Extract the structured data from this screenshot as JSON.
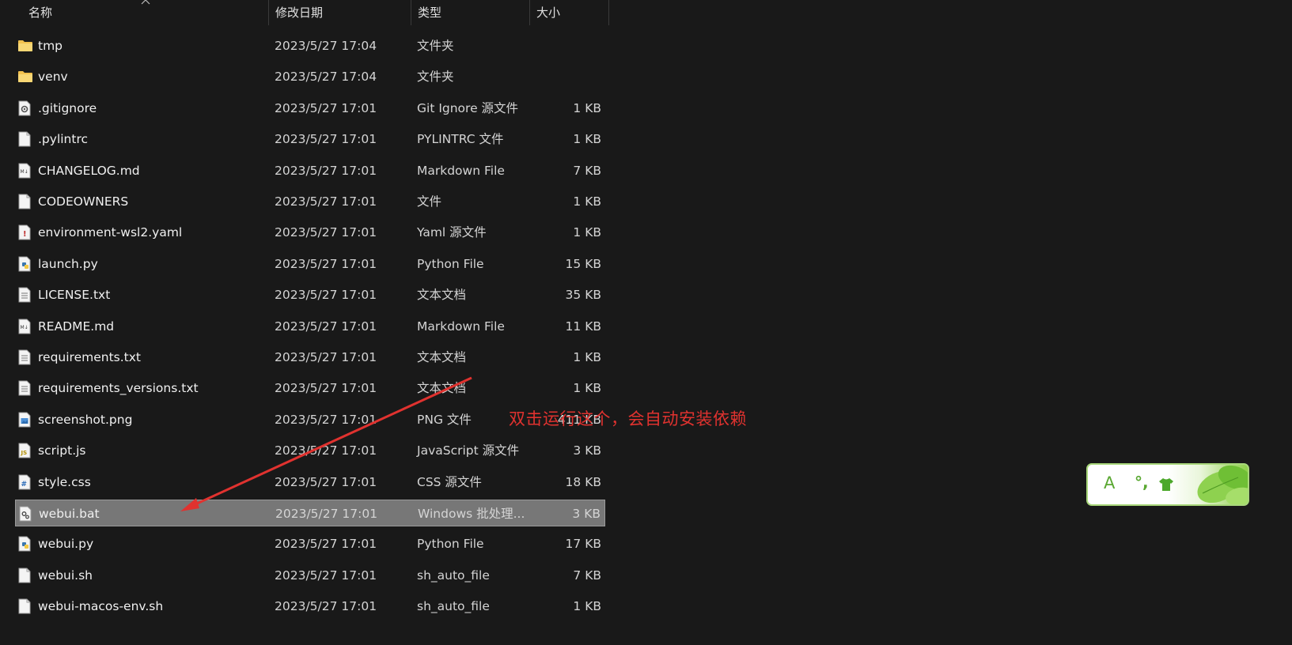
{
  "header": {
    "name": "名称",
    "date": "修改日期",
    "type": "类型",
    "size": "大小"
  },
  "files": [
    {
      "name": "tmp",
      "date": "2023/5/27 17:04",
      "type": "文件夹",
      "size": "",
      "icon": "folder-icon"
    },
    {
      "name": "venv",
      "date": "2023/5/27 17:04",
      "type": "文件夹",
      "size": "",
      "icon": "folder-icon"
    },
    {
      "name": ".gitignore",
      "date": "2023/5/27 17:01",
      "type": "Git Ignore 源文件",
      "size": "1 KB",
      "icon": "config-file-icon"
    },
    {
      "name": ".pylintrc",
      "date": "2023/5/27 17:01",
      "type": "PYLINTRC 文件",
      "size": "1 KB",
      "icon": "blank-file-icon"
    },
    {
      "name": "CHANGELOG.md",
      "date": "2023/5/27 17:01",
      "type": "Markdown File",
      "size": "7 KB",
      "icon": "markdown-file-icon"
    },
    {
      "name": "CODEOWNERS",
      "date": "2023/5/27 17:01",
      "type": "文件",
      "size": "1 KB",
      "icon": "blank-file-icon"
    },
    {
      "name": "environment-wsl2.yaml",
      "date": "2023/5/27 17:01",
      "type": "Yaml 源文件",
      "size": "1 KB",
      "icon": "yaml-file-icon"
    },
    {
      "name": "launch.py",
      "date": "2023/5/27 17:01",
      "type": "Python File",
      "size": "15 KB",
      "icon": "python-file-icon"
    },
    {
      "name": "LICENSE.txt",
      "date": "2023/5/27 17:01",
      "type": "文本文档",
      "size": "35 KB",
      "icon": "text-file-icon"
    },
    {
      "name": "README.md",
      "date": "2023/5/27 17:01",
      "type": "Markdown File",
      "size": "11 KB",
      "icon": "markdown-file-icon"
    },
    {
      "name": "requirements.txt",
      "date": "2023/5/27 17:01",
      "type": "文本文档",
      "size": "1 KB",
      "icon": "text-file-icon"
    },
    {
      "name": "requirements_versions.txt",
      "date": "2023/5/27 17:01",
      "type": "文本文档",
      "size": "1 KB",
      "icon": "text-file-icon"
    },
    {
      "name": "screenshot.png",
      "date": "2023/5/27 17:01",
      "type": "PNG 文件",
      "size": "411 KB",
      "icon": "image-file-icon"
    },
    {
      "name": "script.js",
      "date": "2023/5/27 17:01",
      "type": "JavaScript 源文件",
      "size": "3 KB",
      "icon": "js-file-icon"
    },
    {
      "name": "style.css",
      "date": "2023/5/27 17:01",
      "type": "CSS 源文件",
      "size": "18 KB",
      "icon": "css-file-icon"
    },
    {
      "name": "webui.bat",
      "date": "2023/5/27 17:01",
      "type": "Windows 批处理...",
      "size": "3 KB",
      "icon": "batch-file-icon",
      "selected": true
    },
    {
      "name": "webui.py",
      "date": "2023/5/27 17:01",
      "type": "Python File",
      "size": "17 KB",
      "icon": "python-file-icon"
    },
    {
      "name": "webui.sh",
      "date": "2023/5/27 17:01",
      "type": "sh_auto_file",
      "size": "7 KB",
      "icon": "blank-file-icon"
    },
    {
      "name": "webui-macos-env.sh",
      "date": "2023/5/27 17:01",
      "type": "sh_auto_file",
      "size": "1 KB",
      "icon": "blank-file-icon"
    }
  ],
  "annotation": {
    "text": "双击运行这个，会自动安装依赖",
    "color": "#e0322f"
  },
  "ime": {
    "mode_label": "A",
    "punct_label": "°,",
    "skin_icon": "tshirt-icon"
  },
  "colors": {
    "background": "#191919",
    "selected_row": "#777777",
    "folder": "#f2c14e",
    "annotation": "#e0322f"
  }
}
